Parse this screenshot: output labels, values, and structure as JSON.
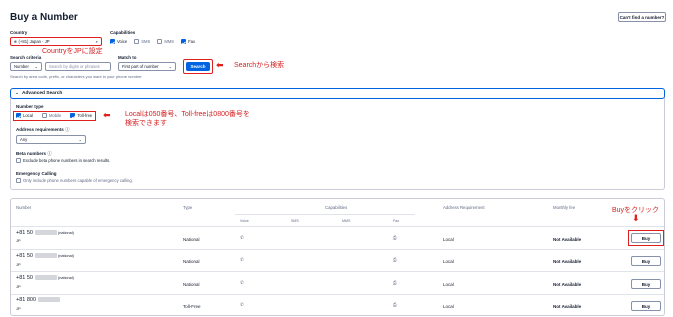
{
  "page": {
    "title": "Buy a Number",
    "cant_find_label": "Can't find a number?"
  },
  "country": {
    "label": "Country",
    "value": "(+81) Japan - JP"
  },
  "capabilities": {
    "label": "Capabilities",
    "items": [
      {
        "label": "Voice",
        "checked": true
      },
      {
        "label": "SMS",
        "checked": false
      },
      {
        "label": "MMS",
        "checked": false
      },
      {
        "label": "Fax",
        "checked": true
      }
    ]
  },
  "search": {
    "criteria_label": "Search criteria",
    "criteria_value": "Number",
    "input_placeholder": "Search by digits or phrases",
    "match_label": "Match to",
    "match_value": "First part of number",
    "button_label": "Search",
    "hint": "Search by area code, prefix, or characters you want in your phone number."
  },
  "advanced": {
    "header": "Advanced Search",
    "number_type_label": "Number type",
    "number_types": [
      {
        "label": "Local",
        "checked": true
      },
      {
        "label": "Mobile",
        "checked": false
      },
      {
        "label": "Toll-free",
        "checked": true
      }
    ],
    "address_label": "Address requirements",
    "address_value": "Any",
    "beta_label": "Beta numbers",
    "beta_option": "Exclude beta phone numbers in search results.",
    "emergency_label": "Emergency Calling",
    "emergency_option": "Only include phone numbers capable of emergency calling."
  },
  "annotations": {
    "country_note": "CountryをJPに設定",
    "search_note": "Searchから検索",
    "local_note_line1": "Localは050番号、Toll-freeは0800番号を",
    "local_note_line2": "検索できます",
    "buy_note": "Buyをクリック"
  },
  "table": {
    "headers": {
      "number": "Number",
      "type": "Type",
      "capabilities": "Capabilities",
      "address": "Address Requirement",
      "fee": "Monthly fee"
    },
    "cap_headers": [
      "Voice",
      "SMS",
      "MMS",
      "Fax"
    ],
    "rows": [
      {
        "number": "+81 50",
        "tag": "(national)",
        "country": "JP",
        "type": "National",
        "address": "Local",
        "fee": "Not Available",
        "buy": "Buy"
      },
      {
        "number": "+81 50",
        "tag": "(national)",
        "country": "JP",
        "type": "National",
        "address": "Local",
        "fee": "Not Available",
        "buy": "Buy"
      },
      {
        "number": "+81 50",
        "tag": "(national)",
        "country": "JP",
        "type": "National",
        "address": "Local",
        "fee": "Not Available",
        "buy": "Buy"
      },
      {
        "number": "+81 800",
        "tag": "",
        "country": "JP",
        "type": "Toll-Free",
        "address": "Local",
        "fee": "Not Available",
        "buy": "Buy"
      }
    ]
  },
  "colors": {
    "accent": "#0263e0",
    "annotation": "#e01f1f"
  }
}
